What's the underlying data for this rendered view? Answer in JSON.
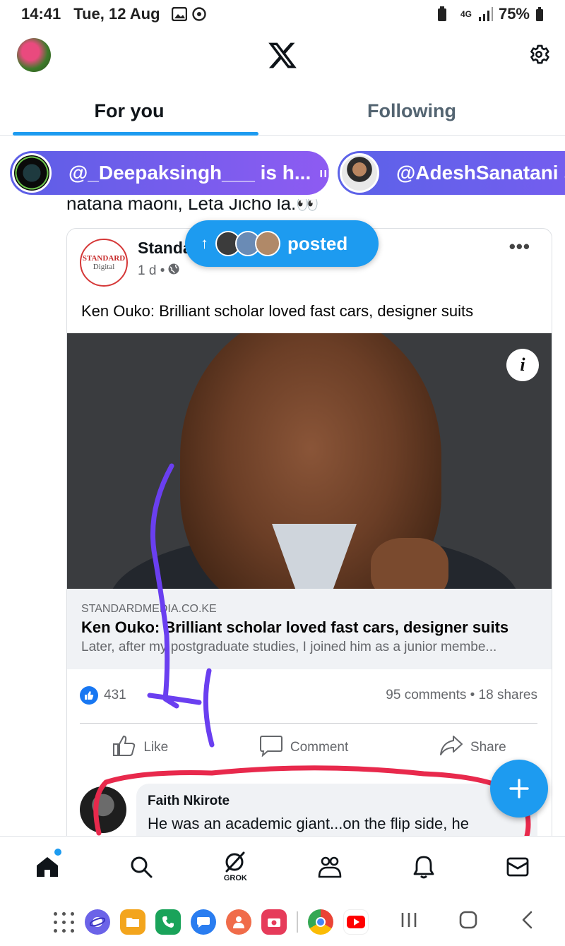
{
  "status_bar": {
    "time": "14:41",
    "date": "Tue, 12 Aug",
    "network": "4G",
    "battery": "75%"
  },
  "header": {
    "logo_icon": "x-logo-icon",
    "settings_icon": "gear-icon"
  },
  "tabs": [
    {
      "label": "For you",
      "active": true
    },
    {
      "label": "Following",
      "active": false
    }
  ],
  "spaces": [
    {
      "label": "@_Deepaksingh___ is h...",
      "indicator": "ııı"
    },
    {
      "label": "@AdeshSanatani s"
    }
  ],
  "tweet_text_cut": "natana maoni, Leta Jicho la.👀",
  "new_posts_pill": {
    "arrow": "↑",
    "label": "posted"
  },
  "fb_post": {
    "page_logo_line1": "STANDARD",
    "page_logo_line2": "Digital",
    "page_name": "Standa",
    "meta": "1 d •",
    "menu": "•••",
    "headline": "Ken Ouko: Brilliant scholar loved fast cars, designer suits",
    "info_button": "i",
    "link": {
      "domain": "STANDARDMEDIA.CO.KE",
      "title": "Ken Ouko: Brilliant scholar loved fast cars, designer suits",
      "description": "Later, after my postgraduate studies, I joined him as a junior membe..."
    },
    "likes": "431",
    "stats": "95 comments • 18 shares",
    "actions": {
      "like": "Like",
      "comment": "Comment",
      "share": "Share"
    },
    "comment": {
      "author": "Faith Nkirote",
      "text": "He was an academic giant...on the flip side, he"
    }
  },
  "bottom_nav": {
    "grok_label": "GROK"
  },
  "colors": {
    "accent": "#1d9bf0",
    "annotation_purple": "#6a3ff0",
    "annotation_red": "#e8294c"
  }
}
